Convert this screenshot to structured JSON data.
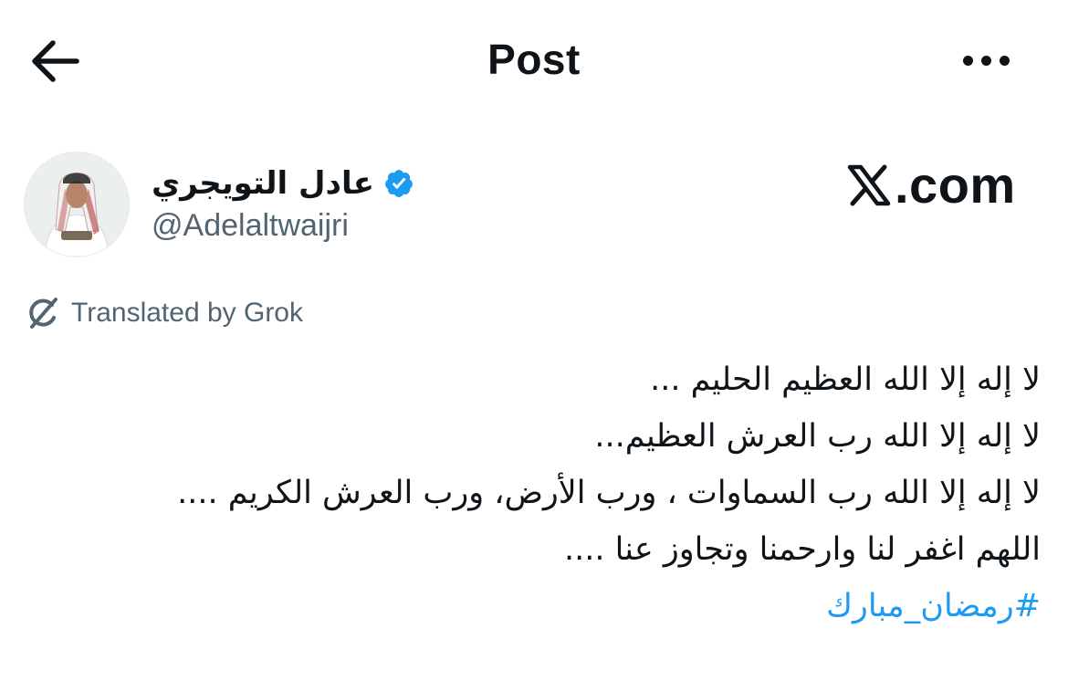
{
  "header": {
    "back_icon": "arrow-left-icon",
    "title": "Post",
    "more_icon": "more-dots-icon"
  },
  "author": {
    "display_name": "عادل التويجري",
    "verified_icon": "verified-badge-icon",
    "verified_color": "#1d9bf0",
    "handle": "@Adelaltwaijri"
  },
  "watermark": {
    "text": ".com",
    "logo_icon": "x-logo-icon"
  },
  "translation": {
    "icon": "grok-icon",
    "label": "Translated by Grok"
  },
  "post": {
    "lines": [
      "لا إله إلا الله العظيم الحليم ...",
      "لا إله إلا الله رب العرش العظيم...",
      "لا إله إلا الله رب السماوات ،  ورب الأرض، ورب العرش الكريم ....",
      "اللهم اغفر لنا وارحمنا وتجاوز عنا ...."
    ],
    "hashtag": "#رمضان_مبارك",
    "hashtag_color": "#1d9bf0"
  }
}
